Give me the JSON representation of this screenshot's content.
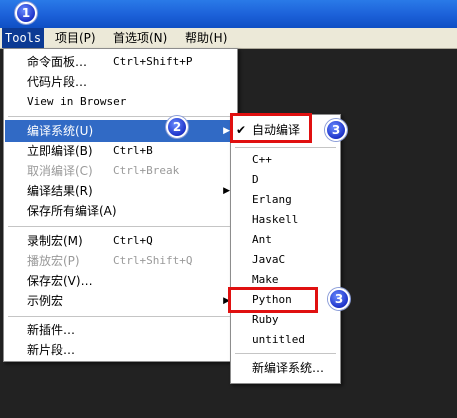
{
  "menubar": {
    "items": [
      "Tools",
      "项目(P)",
      "首选项(N)",
      "帮助(H)"
    ]
  },
  "tools_menu": {
    "items": [
      {
        "label": "命令面板…",
        "shortcut": "Ctrl+Shift+P"
      },
      {
        "label": "代码片段…",
        "shortcut": ""
      },
      {
        "label": "View in Browser",
        "shortcut": ""
      },
      {
        "label": "编译系统(U)",
        "shortcut": ""
      },
      {
        "label": "立即编译(B)",
        "shortcut": "Ctrl+B"
      },
      {
        "label": "取消编译(C)",
        "shortcut": "Ctrl+Break"
      },
      {
        "label": "编译结果(R)",
        "shortcut": ""
      },
      {
        "label": "保存所有编译(A)",
        "shortcut": ""
      },
      {
        "label": "录制宏(M)",
        "shortcut": "Ctrl+Q"
      },
      {
        "label": "播放宏(P)",
        "shortcut": "Ctrl+Shift+Q"
      },
      {
        "label": "保存宏(V)…",
        "shortcut": ""
      },
      {
        "label": "示例宏",
        "shortcut": ""
      },
      {
        "label": "新插件…",
        "shortcut": ""
      },
      {
        "label": "新片段…",
        "shortcut": ""
      }
    ]
  },
  "build_submenu": {
    "items": [
      "自动编译",
      "C++",
      "D",
      "Erlang",
      "Haskell",
      "Ant",
      "JavaC",
      "Make",
      "Python",
      "Ruby",
      "untitled",
      "新编译系统…"
    ]
  },
  "badges": [
    "1",
    "2",
    "3",
    "3"
  ],
  "colors": {
    "annotation_red": "#e01010",
    "highlight": "#316ac5",
    "badge_blue": "#1e33c9"
  }
}
